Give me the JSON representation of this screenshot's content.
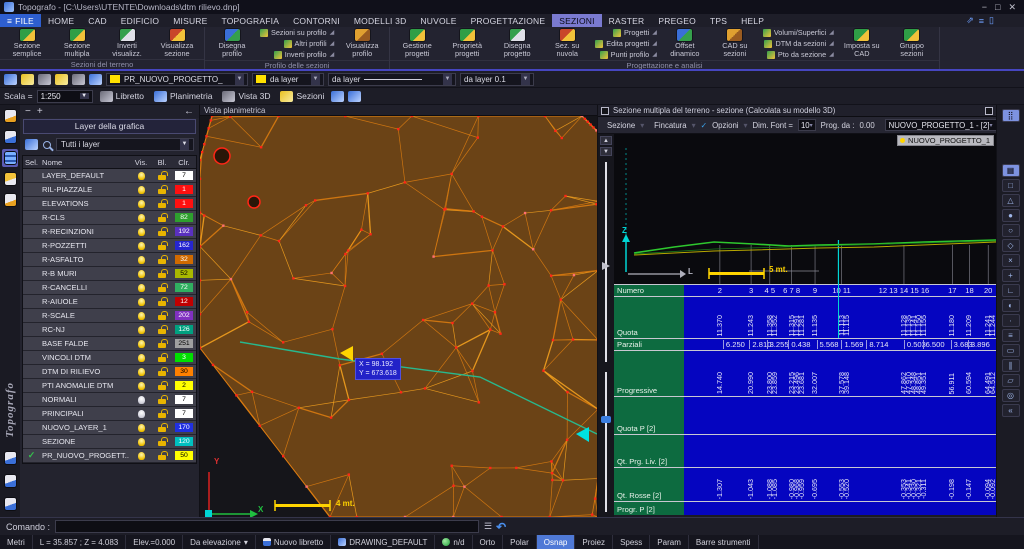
{
  "window": {
    "title": "Topografo - [C:\\Users\\UTENTE\\Downloads\\dtm rilievo.dnp]",
    "minimize": "−",
    "maximize": "□",
    "close": "✕"
  },
  "menu": {
    "items": [
      {
        "label": "FILE",
        "accent": true
      },
      {
        "label": "HOME"
      },
      {
        "label": "CAD"
      },
      {
        "label": "EDIFICIO"
      },
      {
        "label": "MISURE"
      },
      {
        "label": "TOPOGRAFIA"
      },
      {
        "label": "CONTORNI"
      },
      {
        "label": "MODELLI 3D"
      },
      {
        "label": "NUVOLE"
      },
      {
        "label": "PROGETTAZIONE"
      },
      {
        "label": "SEZIONI",
        "active": true
      },
      {
        "label": "RASTER"
      },
      {
        "label": "PREGEO"
      },
      {
        "label": "TPS"
      },
      {
        "label": "HELP"
      }
    ]
  },
  "ribbon": {
    "groups": [
      {
        "label": "Sezioni del terreno",
        "items": [
          {
            "type": "big",
            "label": "Sezione\nsemplice",
            "icon": "section-simple-icon"
          },
          {
            "type": "big",
            "label": "Sezione\nmultipla",
            "icon": "section-multiple-icon"
          },
          {
            "type": "big",
            "label": "Inverti\nvisualizz.",
            "icon": "invert-view-icon"
          },
          {
            "type": "big",
            "label": "Visualizza\nsezione",
            "icon": "view-section-icon"
          }
        ]
      },
      {
        "label": "Profilo delle sezioni",
        "items": [
          {
            "type": "big",
            "label": "Disegna\nprofilo",
            "icon": "draw-profile-icon"
          },
          {
            "type": "stack",
            "labels": [
              "Sezioni su profilo",
              "Altri profili",
              "Inverti profilo"
            ]
          },
          {
            "type": "big",
            "label": "Visualizza\nprofilo",
            "icon": "view-profile-icon"
          }
        ]
      },
      {
        "label": "Progettazione e analisi",
        "items": [
          {
            "type": "big",
            "label": "Gestione\nprogetti",
            "icon": "manage-projects-icon"
          },
          {
            "type": "big",
            "label": "Proprietà\nprogetti",
            "icon": "project-properties-icon"
          },
          {
            "type": "big",
            "label": "Disegna\nprogetto",
            "icon": "draw-project-icon"
          },
          {
            "type": "big",
            "label": "Sez. su\nnuvola",
            "icon": "section-on-cloud-icon"
          },
          {
            "type": "stack",
            "labels": [
              "Progetti",
              "Edita progetti",
              "Punti profilo"
            ]
          },
          {
            "type": "big",
            "label": "Offset\ndinamico",
            "icon": "dynamic-offset-icon"
          },
          {
            "type": "big",
            "label": "CAD su\nsezioni",
            "icon": "cad-on-sections-icon"
          },
          {
            "type": "stack",
            "labels": [
              "Volumi/Superfici",
              "DTM da sezioni",
              "Pto da sezione"
            ]
          },
          {
            "type": "big",
            "label": "Imposta su\nCAD",
            "icon": "set-on-cad-icon"
          },
          {
            "type": "big",
            "label": "Gruppo\nsezioni",
            "icon": "section-group-icon"
          }
        ]
      }
    ]
  },
  "props_toolbar": {
    "layer_dropdown": "PR_NUOVO_PROGETTO_",
    "color_dropdown": "da layer",
    "linetype_dropdown": "da  layer",
    "lineweight_dropdown": "da layer 0.1",
    "swatch_color": "#ffe000"
  },
  "view_toolbar": {
    "scale_label": "Scala =",
    "scale_value": "1:250",
    "buttons": [
      "Libretto",
      "Planimetria",
      "Vista 3D",
      "Sezioni"
    ]
  },
  "left_strip": {
    "icons": [
      "libretto-notes-icon",
      "codelist-icon",
      "layers-icon",
      "annotate-hand-icon",
      "redline-hand-icon"
    ],
    "active_index": 2,
    "bottom_icons": [
      "assistant-robot-icon",
      "filter-funnel-icon",
      "settings-gear-icon"
    ],
    "brand": "Topografo"
  },
  "layer_panel": {
    "zoom_minus": "−",
    "zoom_plus": "+",
    "back_arrow": "←",
    "title": "Layer della grafica",
    "filter_value": "Tutti i layer",
    "columns": [
      "Sel.",
      "Nome",
      "Vis.",
      "Bl.",
      "Clr."
    ],
    "rows": [
      {
        "name": "LAYER_DEFAULT",
        "clr": "7",
        "color": "#ffffff"
      },
      {
        "name": "RIL-PIAZZALE",
        "clr": "1",
        "color": "#ff1010"
      },
      {
        "name": "ELEVATIONS",
        "clr": "1",
        "color": "#ff1010"
      },
      {
        "name": "R-CLS",
        "clr": "82",
        "color": "#2ea02e"
      },
      {
        "name": "R-RECINZIONI",
        "clr": "192",
        "color": "#5a30c0"
      },
      {
        "name": "R-POZZETTI",
        "clr": "162",
        "color": "#2525d0"
      },
      {
        "name": "R-ASFALTO",
        "clr": "32",
        "color": "#d06a00"
      },
      {
        "name": "R-B MURI",
        "clr": "52",
        "color": "#a8b800"
      },
      {
        "name": "R-CANCELLI",
        "clr": "72",
        "color": "#30b060"
      },
      {
        "name": "R-AIUOLE",
        "clr": "12",
        "color": "#c00000"
      },
      {
        "name": "R-SCALE",
        "clr": "202",
        "color": "#8030c0"
      },
      {
        "name": "RC-NJ",
        "clr": "126",
        "color": "#00a080"
      },
      {
        "name": "BASE FALDE",
        "clr": "251",
        "color": "#a0a0a0"
      },
      {
        "name": "VINCOLI DTM",
        "clr": "3",
        "color": "#00e000"
      },
      {
        "name": "DTM DI RILIEVO",
        "clr": "30",
        "color": "#ff8000"
      },
      {
        "name": "PTI ANOMALIE DTM",
        "clr": "2",
        "color": "#ffff00"
      },
      {
        "name": "NORMALI",
        "clr": "7",
        "color": "#ffffff",
        "bulb_off": true
      },
      {
        "name": "PRINCIPALI",
        "clr": "7",
        "color": "#ffffff",
        "bulb_off": true
      },
      {
        "name": "NUOVO_LAYER_1",
        "clr": "170",
        "color": "#2030e0"
      },
      {
        "name": "SEZIONE",
        "clr": "120",
        "color": "#00c0c0"
      },
      {
        "name": "PR_NUOVO_PROGETT..",
        "clr": "50",
        "color": "#ffff00",
        "checked": true
      }
    ]
  },
  "planimetric_view": {
    "title": "Vista planimetrica",
    "tooltip_x": "X = 98.192",
    "tooltip_y": "Y = 673.618",
    "scale_bar": "4 mt.",
    "axis_x": "X",
    "axis_y": "Y"
  },
  "section_panel": {
    "title": "Sezione multipla del terreno - sezione  (Calcolata su modello 3D)",
    "toolbar": {
      "sezione": "Sezione",
      "fincatura": "Fincatura",
      "opzioni": "Opzioni",
      "dim_font_label": "Dim. Font =",
      "dim_font_value": "10",
      "prog_label": "Prog. da :",
      "prog_value": "0.00",
      "project_dropdown": "NUOVO_PROGETTO_1 - [2]"
    },
    "legend": "NUOVO_PROGETTO_1",
    "axis_z": "Z",
    "axis_l": "L",
    "scale_bar": "5 mt.",
    "table": {
      "row_labels": [
        "Numero",
        "Quota",
        "Parziali",
        "Progressive",
        "Quota P [2]",
        "Qt. Prg. Liv. [2]",
        "Qt. Rosse [2]",
        "Progr. P [2]"
      ],
      "stations": [
        {
          "num": "2",
          "x_pct": 11.5,
          "quota": [
            "11.370"
          ],
          "prog": [
            "14.740"
          ],
          "rossa": [
            "-1.307"
          ]
        },
        {
          "num": "3",
          "x_pct": 21.5,
          "quota": [
            "11.243"
          ],
          "prog": [
            "20.990"
          ],
          "rossa": [
            "-1.043"
          ]
        },
        {
          "num": "4 5",
          "x_pct": 27.5,
          "quota": [
            "11.358",
            "11.352"
          ],
          "prog": [
            "23.800",
            "23.859"
          ],
          "rossa": [
            "-1.088",
            "-1.085"
          ]
        },
        {
          "num": "6 7 8",
          "x_pct": 34.5,
          "quota": [
            "11.315",
            "11.291",
            "11.281"
          ],
          "prog": [
            "23.215",
            "23.496",
            "23.681"
          ],
          "rossa": [
            "-0.980",
            "-0.968",
            "-0.959"
          ]
        },
        {
          "num": "9",
          "x_pct": 42,
          "quota": [
            "11.135"
          ],
          "prog": [
            "32.007"
          ],
          "rossa": [
            "-0.695"
          ]
        },
        {
          "num": "10 11",
          "x_pct": 50.5,
          "quota": [
            "11.113",
            "11.115"
          ],
          "prog": [
            "37.578",
            "39.148"
          ],
          "rossa": [
            "-0.553",
            "-0.520"
          ]
        },
        {
          "num": "12 13 14 15 16",
          "x_pct": 70.5,
          "quota": [
            "11.128",
            "11.135",
            "11.141",
            "11.150",
            "11.155"
          ],
          "prog": [
            "47.862",
            "47.910",
            "48.348",
            "48.851",
            "49.351"
          ],
          "rossa": [
            "-0.353",
            "-0.341",
            "-0.330",
            "-0.321",
            "-0.311"
          ]
        },
        {
          "num": "17",
          "x_pct": 86,
          "quota": [
            "11.180"
          ],
          "prog": [
            "56.911"
          ],
          "rossa": [
            "-0.198"
          ]
        },
        {
          "num": "18",
          "x_pct": 91.5,
          "quota": [
            "11.209"
          ],
          "prog": [
            "60.594"
          ],
          "rossa": [
            "-0.147"
          ]
        },
        {
          "num": "19 20",
          "x_pct": 97.5,
          "quota": [
            "11.241",
            "11.244"
          ],
          "prog": [
            "64.491",
            "64.512"
          ],
          "rossa": [
            "-0.094",
            "-0.092"
          ]
        }
      ],
      "parziali": [
        {
          "x_pct": 16,
          "v": "6.250"
        },
        {
          "x_pct": 24.5,
          "v": "2.810"
        },
        {
          "x_pct": 30,
          "v": "3.255"
        },
        {
          "x_pct": 37,
          "v": "0.438"
        },
        {
          "x_pct": 46,
          "v": "5.568"
        },
        {
          "x_pct": 54,
          "v": "1.569"
        },
        {
          "x_pct": 62,
          "v": "8.714"
        },
        {
          "x_pct": 74,
          "v": "0.503"
        },
        {
          "x_pct": 80,
          "v": "6.500"
        },
        {
          "x_pct": 89,
          "v": "3.683"
        },
        {
          "x_pct": 94.5,
          "v": "3.896"
        }
      ],
      "marker_x_pct": 49.5
    }
  },
  "right_toolbar": {
    "icons": [
      "pan-icon",
      "layout-icon",
      "endpoint-snap-icon",
      "midpoint-snap-icon",
      "center-snap-icon",
      "node-snap-icon",
      "quadrant-snap-icon",
      "intersection-snap-icon",
      "extension-snap-icon",
      "insertion-snap-icon",
      "perpendicular-snap-icon",
      "tangent-snap-icon",
      "nearest-snap-icon",
      "apparent-intersection-snap-icon",
      "parallel-snap-icon",
      "polyline-snap-icon",
      "osnap-settings-icon",
      "clear-snap-icon"
    ],
    "glyphs": [
      "⣿",
      "▦",
      "□",
      "△",
      "●",
      "○",
      "◇",
      "×",
      "+",
      "∟",
      "◐",
      "∙",
      "≡",
      "▭",
      "∥",
      "▱",
      "◎",
      "«"
    ]
  },
  "command_bar": {
    "label": "Comando :"
  },
  "status_bar": {
    "items": [
      {
        "label": "Metri"
      },
      {
        "label": "L = 35.857 ; Z = 4.083"
      },
      {
        "label": "Elev.=0.000"
      },
      {
        "label": "Da elevazione",
        "dropdown": true
      },
      {
        "label": "Nuovo libretto",
        "icon": "book"
      },
      {
        "label": "DRAWING_DEFAULT",
        "icon": "draw"
      },
      {
        "label": "n/d",
        "icon": "globe"
      },
      {
        "label": "Orto"
      },
      {
        "label": "Polar"
      },
      {
        "label": "Osnap",
        "active": true
      },
      {
        "label": "Proiez"
      },
      {
        "label": "Spess"
      },
      {
        "label": "Param"
      },
      {
        "label": "Barre strumenti"
      }
    ]
  }
}
